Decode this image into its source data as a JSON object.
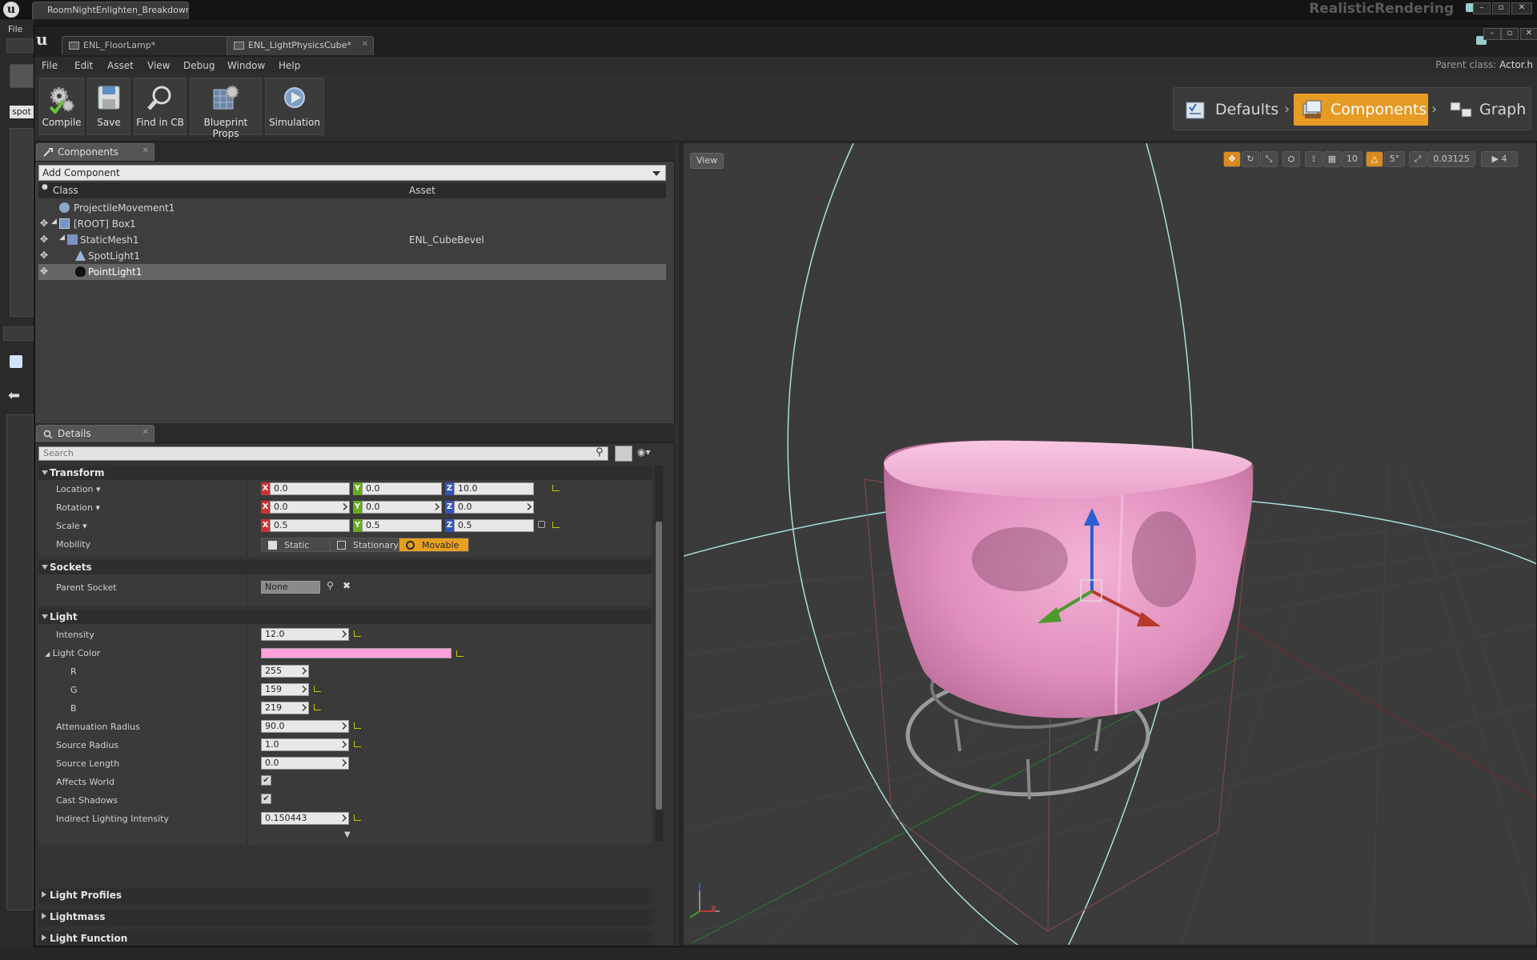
{
  "outer": {
    "tab_title": "RoomNightEnlighten_Breakdown",
    "project_name": "RealisticRendering",
    "file_menu": "File",
    "left_search_value": "spot"
  },
  "bp": {
    "tabs": [
      {
        "label": "ENL_FloorLamp*"
      },
      {
        "label": "ENL_LightPhysicsCube*"
      }
    ],
    "menu": [
      "File",
      "Edit",
      "Asset",
      "View",
      "Debug",
      "Window",
      "Help"
    ],
    "parent_class_label": "Parent class:",
    "parent_class_value": "Actor.h",
    "toolbar": {
      "compile": "Compile",
      "save": "Save",
      "find": "Find in CB",
      "blueprint_props": "Blueprint Props",
      "simulation": "Simulation"
    },
    "modes": {
      "defaults": "Defaults",
      "components": "Components",
      "graph": "Graph"
    }
  },
  "components": {
    "tab_label": "Components",
    "add_label": "Add Component",
    "col_class": "Class",
    "col_asset": "Asset",
    "rows": [
      {
        "name": "ProjectileMovement1",
        "asset": ""
      },
      {
        "name": "[ROOT] Box1",
        "asset": ""
      },
      {
        "name": "StaticMesh1",
        "asset": "ENL_CubeBevel"
      },
      {
        "name": "SpotLight1",
        "asset": ""
      },
      {
        "name": "PointLight1",
        "asset": ""
      }
    ]
  },
  "details": {
    "tab_label": "Details",
    "search_placeholder": "Search",
    "transform": {
      "title": "Transform",
      "location_label": "Location",
      "rotation_label": "Rotation",
      "scale_label": "Scale",
      "mobility_label": "Mobility",
      "location": {
        "x": "0.0",
        "y": "0.0",
        "z": "10.0"
      },
      "rotation": {
        "x": "0.0",
        "y": "0.0",
        "z": "0.0"
      },
      "scale": {
        "x": "0.5",
        "y": "0.5",
        "z": "0.5"
      },
      "mobility_options": [
        "Static",
        "Stationary",
        "Movable"
      ],
      "mobility_selected": "Movable",
      "axis_x": "X",
      "axis_y": "Y",
      "axis_z": "Z"
    },
    "sockets": {
      "title": "Sockets",
      "parent_socket_label": "Parent Socket",
      "parent_socket_value": "None"
    },
    "light": {
      "title": "Light",
      "intensity_label": "Intensity",
      "intensity": "12.0",
      "light_color_label": "Light Color",
      "light_color_hex": "#ff9fdb",
      "r_label": "R",
      "r": "255",
      "g_label": "G",
      "g": "159",
      "b_label": "B",
      "b": "219",
      "attenuation_label": "Attenuation Radius",
      "attenuation": "90.0",
      "source_radius_label": "Source Radius",
      "source_radius": "1.0",
      "source_length_label": "Source Length",
      "source_length": "0.0",
      "affects_world_label": "Affects World",
      "cast_shadows_label": "Cast Shadows",
      "indirect_label": "Indirect Lighting Intensity",
      "indirect": "0.150443"
    },
    "collapsed": [
      "Light Profiles",
      "Lightmass",
      "Light Function"
    ]
  },
  "viewport": {
    "view_label": "View",
    "grid_snap": "10",
    "rot_snap": "5°",
    "scale_snap": "0.03125",
    "camera_speed": "4",
    "axis_x": "X"
  },
  "colors": {
    "accent_orange": "#e59b24",
    "cube_pink": "#e89ac4",
    "light_color": "#ff9fdb"
  }
}
